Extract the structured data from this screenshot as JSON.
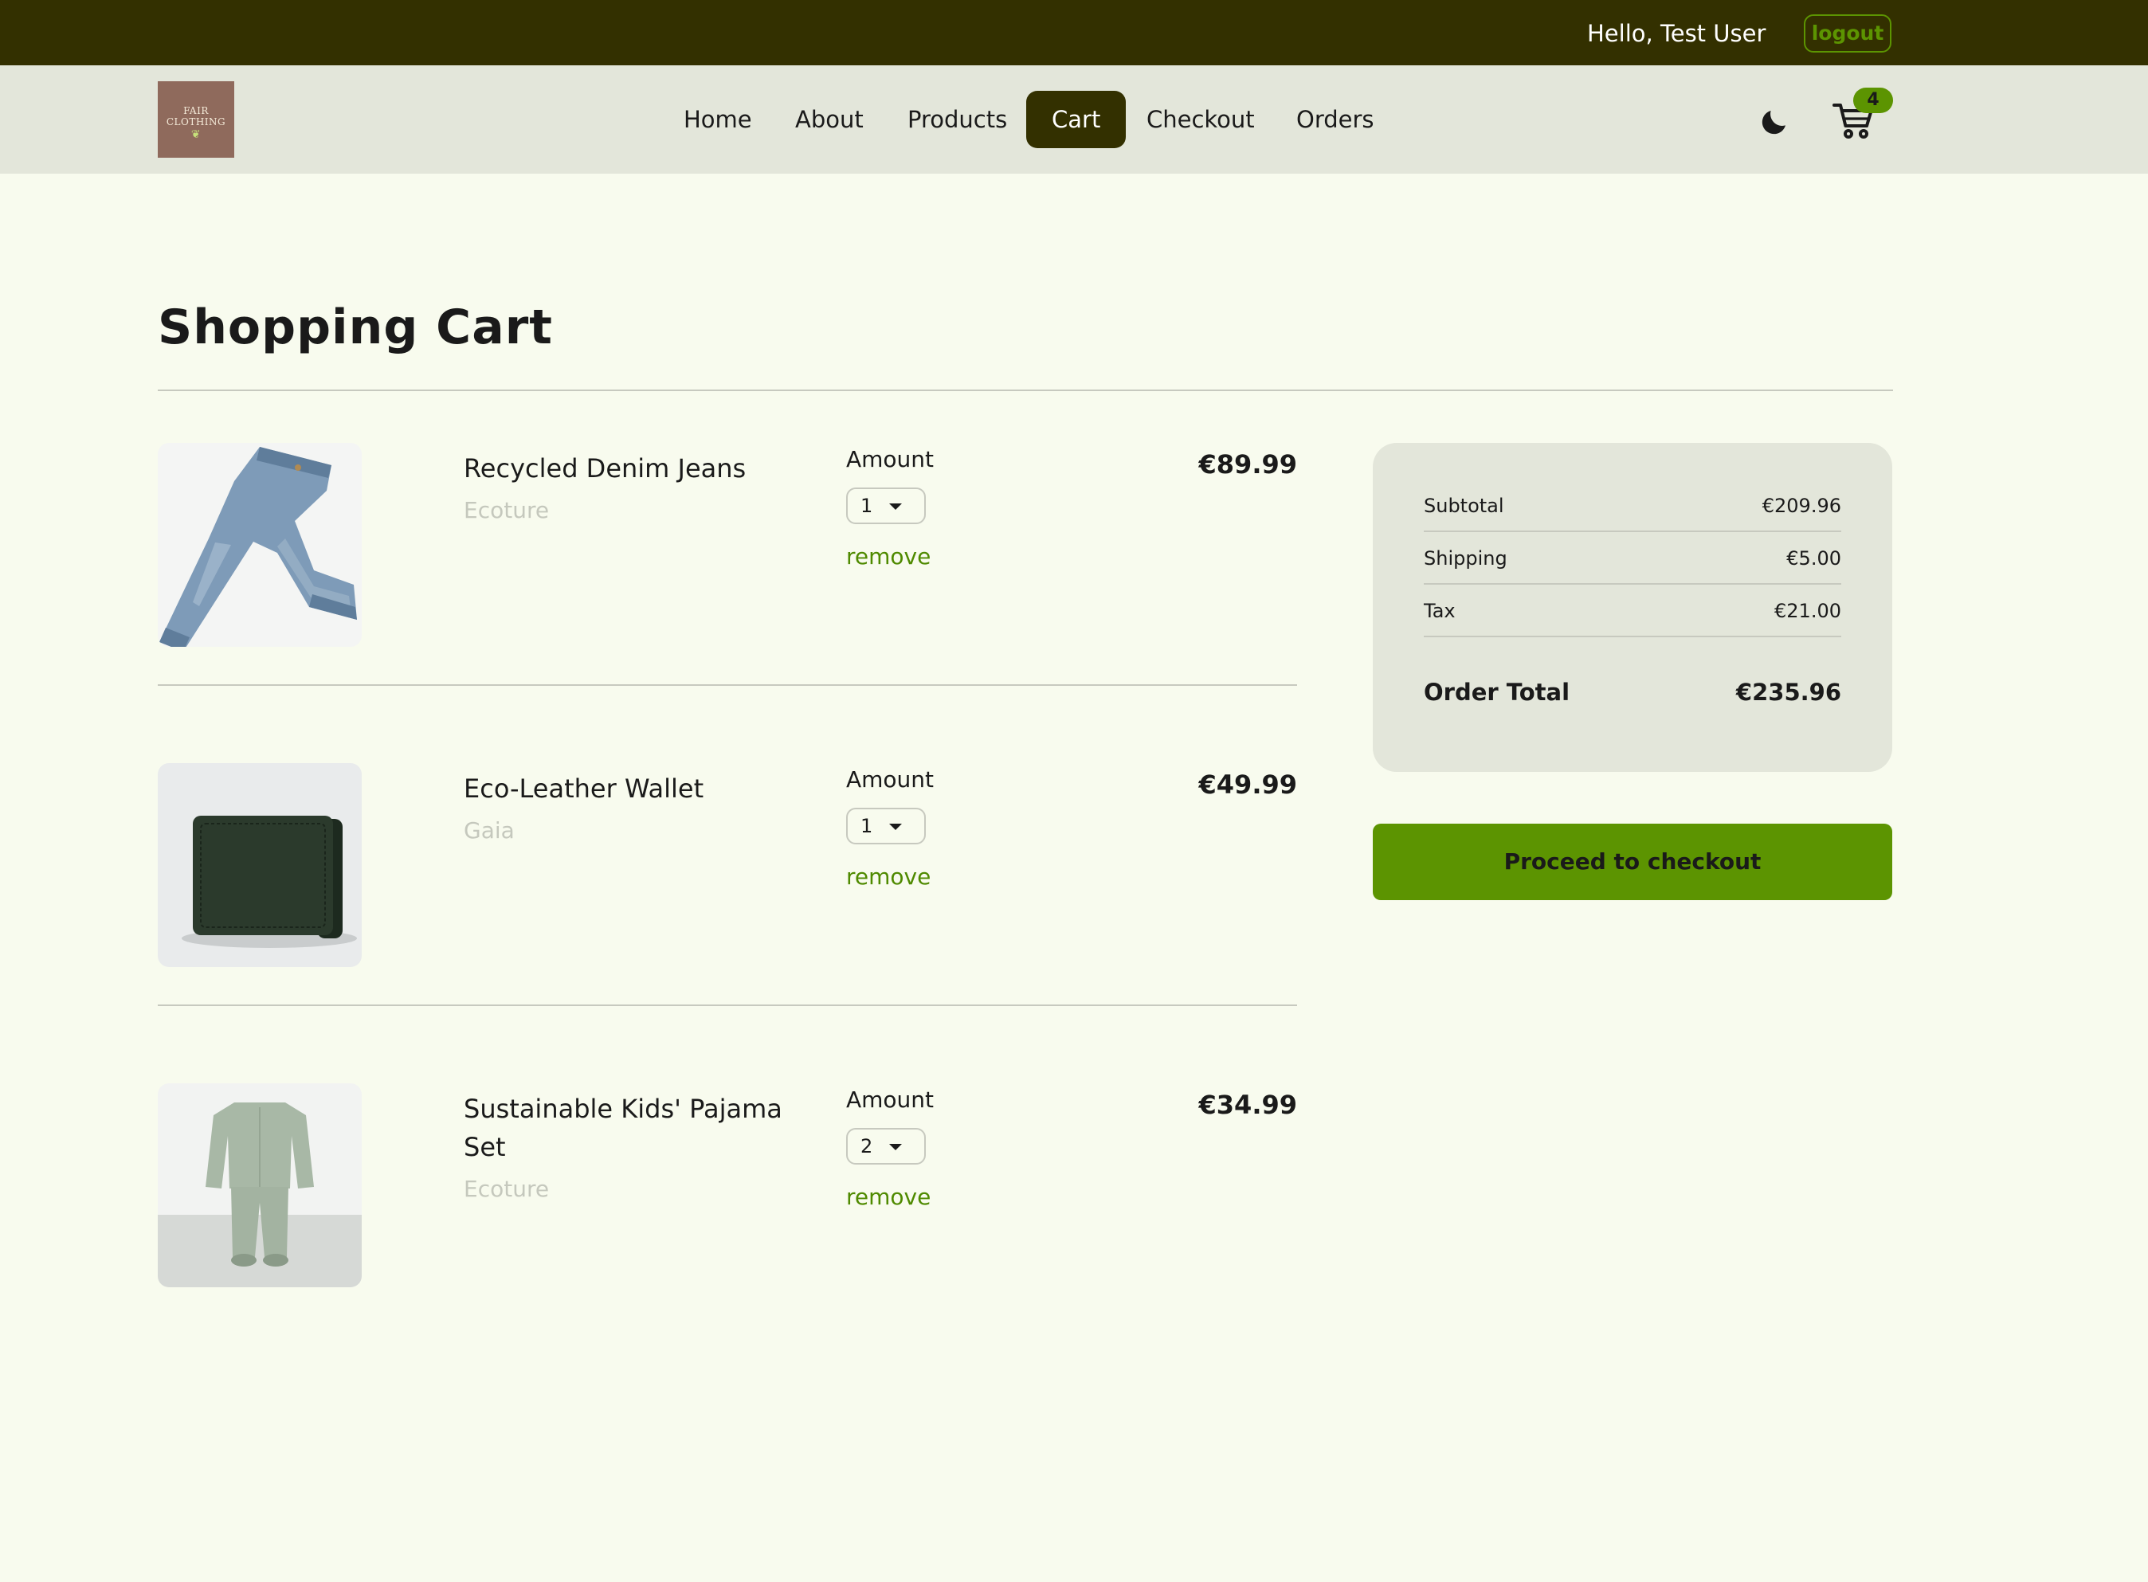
{
  "header": {
    "greeting": "Hello, Test User",
    "logout_label": "logout"
  },
  "nav": {
    "logo_line1": "FAIR",
    "logo_line2": "CLOTHING",
    "links": [
      "Home",
      "About",
      "Products",
      "Cart",
      "Checkout",
      "Orders"
    ],
    "active": "Cart",
    "cart_count": "4",
    "icons": [
      "moon-icon",
      "shopping-cart-icon"
    ]
  },
  "page": {
    "title": "Shopping Cart"
  },
  "cart": {
    "amount_label": "Amount",
    "remove_label": "remove",
    "items": [
      {
        "name": "Recycled Denim Jeans",
        "brand": "Ecoture",
        "quantity": "1",
        "price": "€89.99",
        "image": "jeans"
      },
      {
        "name": "Eco-Leather Wallet",
        "brand": "Gaia",
        "quantity": "1",
        "price": "€49.99",
        "image": "wallet"
      },
      {
        "name": "Sustainable Kids' Pajama Set",
        "brand": "Ecoture",
        "quantity": "2",
        "price": "€34.99",
        "image": "pajama"
      }
    ]
  },
  "summary": {
    "subtotal_label": "Subtotal",
    "subtotal": "€209.96",
    "shipping_label": "Shipping",
    "shipping": "€5.00",
    "tax_label": "Tax",
    "tax": "€21.00",
    "total_label": "Order Total",
    "total": "€235.96"
  },
  "checkout_button": "Proceed to checkout",
  "colors": {
    "topbar": "#333000",
    "navbar": "#e3e6da",
    "background": "#f8fbee",
    "accent": "#5c9401"
  }
}
